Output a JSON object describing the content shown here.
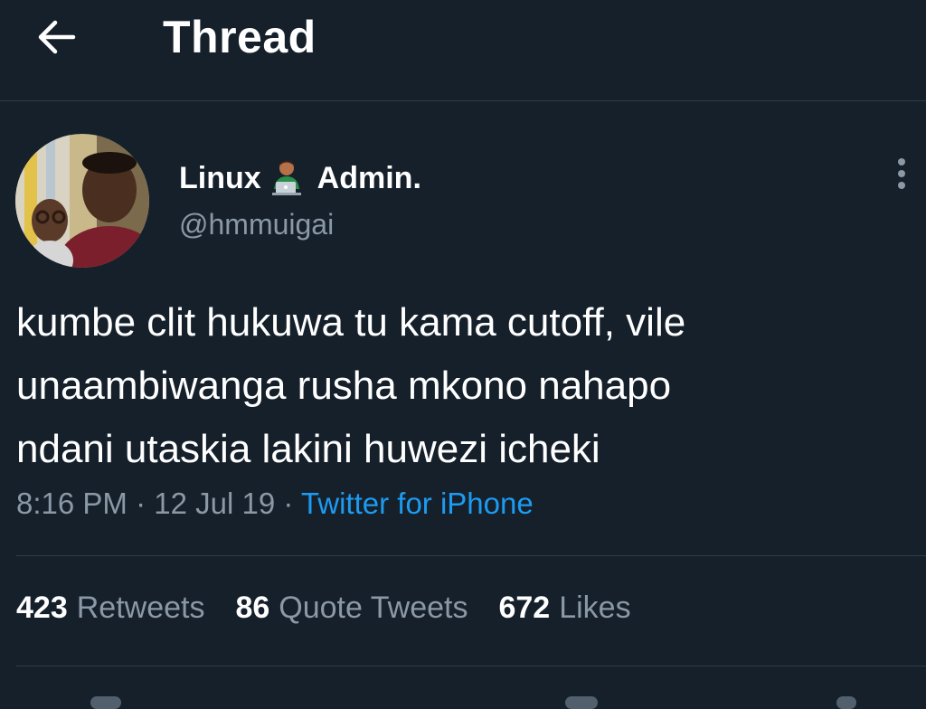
{
  "header": {
    "back_icon": "arrow-left-icon",
    "title": "Thread"
  },
  "tweet": {
    "author": {
      "name_part1": "Linux",
      "name_emoji": "man-technologist-emoji",
      "name_part2": "Admin.",
      "handle": "@hmmuigai",
      "avatar": "avatar-photo"
    },
    "more_icon": "more-vertical-icon",
    "text": "kumbe clit hukuwa tu kama cutoff, vile\nunaambiwanga rusha mkono nahapo\nndani utaskia lakini huwezi icheki",
    "time": "8:16 PM",
    "separator": "·",
    "date": "12 Jul 19",
    "source": "Twitter for iPhone"
  },
  "stats": {
    "retweets_count": "423",
    "retweets_label": "Retweets",
    "quotes_count": "86",
    "quotes_label": "Quote Tweets",
    "likes_count": "672",
    "likes_label": "Likes"
  },
  "colors": {
    "background": "#15202b",
    "divider": "#2f3b46",
    "secondary_text": "#8b98a5",
    "accent": "#1d9bf0"
  }
}
